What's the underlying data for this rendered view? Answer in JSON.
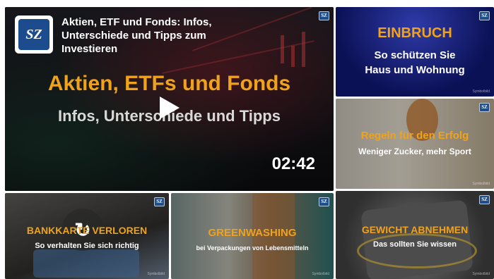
{
  "main_video": {
    "logo_text": "SZ",
    "title": "Aktien, ETF und Fonds: Infos, Unterschiede und Tipps zum Investieren",
    "thumb_title": "Aktien, ETFs und Fonds",
    "thumb_subtitle": "Infos, Unterschiede und Tipps",
    "duration": "02:42",
    "badge": "SZ"
  },
  "tiles": [
    {
      "title": "EINBRUCH",
      "subtitle": "So schützen Sie Haus und Wohnung",
      "credit": "Symbolbild",
      "badge": "SZ"
    },
    {
      "title": "Regeln für den Erfolg",
      "subtitle": "Weniger Zucker, mehr Sport",
      "credit": "Symbolbild",
      "badge": "SZ"
    },
    {
      "title": "BANKKARTE VERLOREN",
      "subtitle": "So verhalten Sie sich richtig",
      "credit": "Symbolbild",
      "badge": "SZ"
    },
    {
      "title": "GREENWASHING",
      "subtitle": "bei Verpackungen von Lebensmitteln",
      "credit": "Symbolbild",
      "badge": "SZ"
    },
    {
      "title": "GEWICHT ABNEHMEN",
      "subtitle": "Das sollten Sie wissen",
      "credit": "Symbolbild",
      "badge": "SZ"
    }
  ],
  "colors": {
    "accent_orange": "#f0a21b",
    "brand_blue": "#1c4b8e"
  }
}
